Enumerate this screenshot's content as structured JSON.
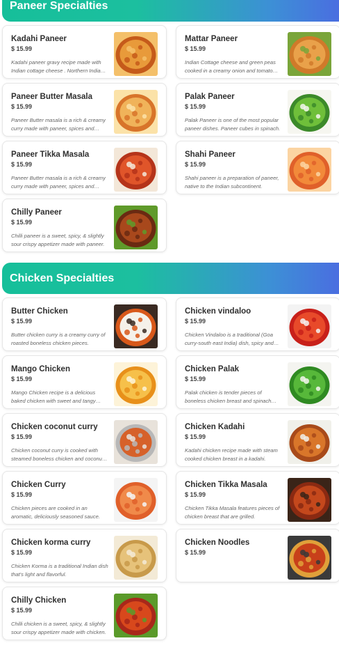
{
  "sections": [
    {
      "title": "Paneer Specialties",
      "items": [
        {
          "name": "Kadahi Paneer",
          "price": "$ 15.99",
          "desc": "Kadahi paneer gravy recipe made with Indian cottage cheese . Northern Indian dish.",
          "image": "kadahi-paneer-image",
          "colors": [
            "#c55a1a",
            "#e89a3a",
            "#f4c06a"
          ]
        },
        {
          "name": "Mattar Paneer",
          "price": "$ 15.99",
          "desc": "Indian Cottage cheese and green peas cooked in a creamy onion and tomato sauce.",
          "image": "mattar-paneer-image",
          "colors": [
            "#d07a2a",
            "#e9a14a",
            "#7aa53a"
          ]
        },
        {
          "name": "Paneer Butter Masala",
          "price": "$ 15.99",
          "desc": "Paneer Butter masala is a rich & creamy curry made with paneer, spices and butter.",
          "image": "paneer-butter-masala-image",
          "colors": [
            "#d8742a",
            "#f0b35a",
            "#fbe2a8"
          ]
        },
        {
          "name": "Palak Paneer",
          "price": "$ 15.99",
          "desc": "Palak Paneer is one of the most popular paneer dishes. Paneer cubes in spinach.",
          "image": "palak-paneer-image",
          "colors": [
            "#3c8a2a",
            "#6fbf3a",
            "#f6f6f0"
          ]
        },
        {
          "name": "Paneer Tikka Masala",
          "price": "$ 15.99",
          "desc": "Paneer Butter masala is a rich & creamy curry made with paneer, spices and butter.",
          "image": "paneer-tikka-masala-image",
          "colors": [
            "#b5341a",
            "#e0552a",
            "#f3e7d8"
          ]
        },
        {
          "name": "Shahi Paneer",
          "price": "$ 15.99",
          "desc": "Shahi paneer is a preparation of paneer, native to the Indian subcontinent.",
          "image": "shahi-paneer-image",
          "colors": [
            "#e0602a",
            "#f28a3a",
            "#fbd4a2"
          ]
        },
        {
          "name": "Chilly Paneer",
          "price": "$ 15.99",
          "desc": "Chilli paneer is a sweet, spicy, & slightly sour crispy appetizer made with paneer.",
          "image": "chilly-paneer-image",
          "colors": [
            "#6a2a12",
            "#a8481c",
            "#5f9a2a"
          ]
        }
      ]
    },
    {
      "title": "Chicken Specialties",
      "items": [
        {
          "name": "Butter Chicken",
          "price": "$ 15.99",
          "desc": "Butter chicken curry is a creamy curry of roasted boneless chicken pieces.",
          "image": "butter-chicken-image",
          "colors": [
            "#d8581a",
            "#f5f1ea",
            "#3a2a22"
          ]
        },
        {
          "name": "Chicken vindaloo",
          "price": "$ 15.99",
          "desc": "Chicken Vindaloo is a traditional (Goa curry-south east India) dish, spicy and tangy.",
          "image": "chicken-vindaloo-image",
          "colors": [
            "#c8201a",
            "#e84a2a",
            "#f3f3f3"
          ]
        },
        {
          "name": "Mango Chicken",
          "price": "$ 15.99",
          "desc": "Mango Chicken recipe is a delicious baked chicken with sweet and tangy mango sauce.",
          "image": "mango-chicken-image",
          "colors": [
            "#e8901a",
            "#f6c04a",
            "#fdf3d8"
          ]
        },
        {
          "name": "Chicken Palak",
          "price": "$ 15.99",
          "desc": "Palak chicken is tender pieces of boneless chicken breast and spinach gravy.",
          "image": "chicken-palak-image",
          "colors": [
            "#2f8a22",
            "#57b83a",
            "#f4f4f0"
          ]
        },
        {
          "name": "Chicken coconut curry",
          "price": "$ 15.99",
          "desc": "Chicken coconut curry is cooked with steamed boneless chicken and coconut milk.",
          "image": "chicken-coconut-curry-image",
          "colors": [
            "#b8b8b8",
            "#d6612a",
            "#e8e2da"
          ]
        },
        {
          "name": "Chicken Kadahi",
          "price": "$ 15.99",
          "desc": "Kadahi chicken recipe made with steam cooked chicken breast in a kadahi.",
          "image": "chicken-kadahi-image",
          "colors": [
            "#a84a1a",
            "#d9762a",
            "#f0f0ea"
          ]
        },
        {
          "name": "Chicken Curry",
          "price": "$ 15.99",
          "desc": "Chicken pieces are cooked in an aromatic, deliciously seasoned sauce.",
          "image": "chicken-curry-image",
          "colors": [
            "#e0602a",
            "#f08a4a",
            "#f4f4f4"
          ]
        },
        {
          "name": "Chicken Tikka Masala",
          "price": "$ 15.99",
          "desc": "Chicken Tikka Masala features pieces of chicken breast that are grilled.",
          "image": "chicken-tikka-masala-image",
          "colors": [
            "#8a2a12",
            "#c4481c",
            "#3a2418"
          ]
        },
        {
          "name": "Chicken korma curry",
          "price": "$ 15.99",
          "desc": "Chicken Korma is a traditional Indian dish that's light and flavorful.",
          "image": "chicken-korma-curry-image",
          "colors": [
            "#c89a4a",
            "#e6c27a",
            "#f3ead6"
          ]
        },
        {
          "name": "Chicken Noodles",
          "price": "$ 15.99",
          "desc": "",
          "image": "chicken-noodles-image",
          "colors": [
            "#e0a03a",
            "#c8401a",
            "#3a3a3a"
          ]
        },
        {
          "name": "Chilly Chicken",
          "price": "$ 15.99",
          "desc": "Chilli chicken is a sweet, spicy, & slightly sour crispy appetizer made with chicken.",
          "image": "chilly-chicken-image",
          "colors": [
            "#a8281a",
            "#d8481c",
            "#5a9a2a"
          ]
        }
      ]
    }
  ]
}
